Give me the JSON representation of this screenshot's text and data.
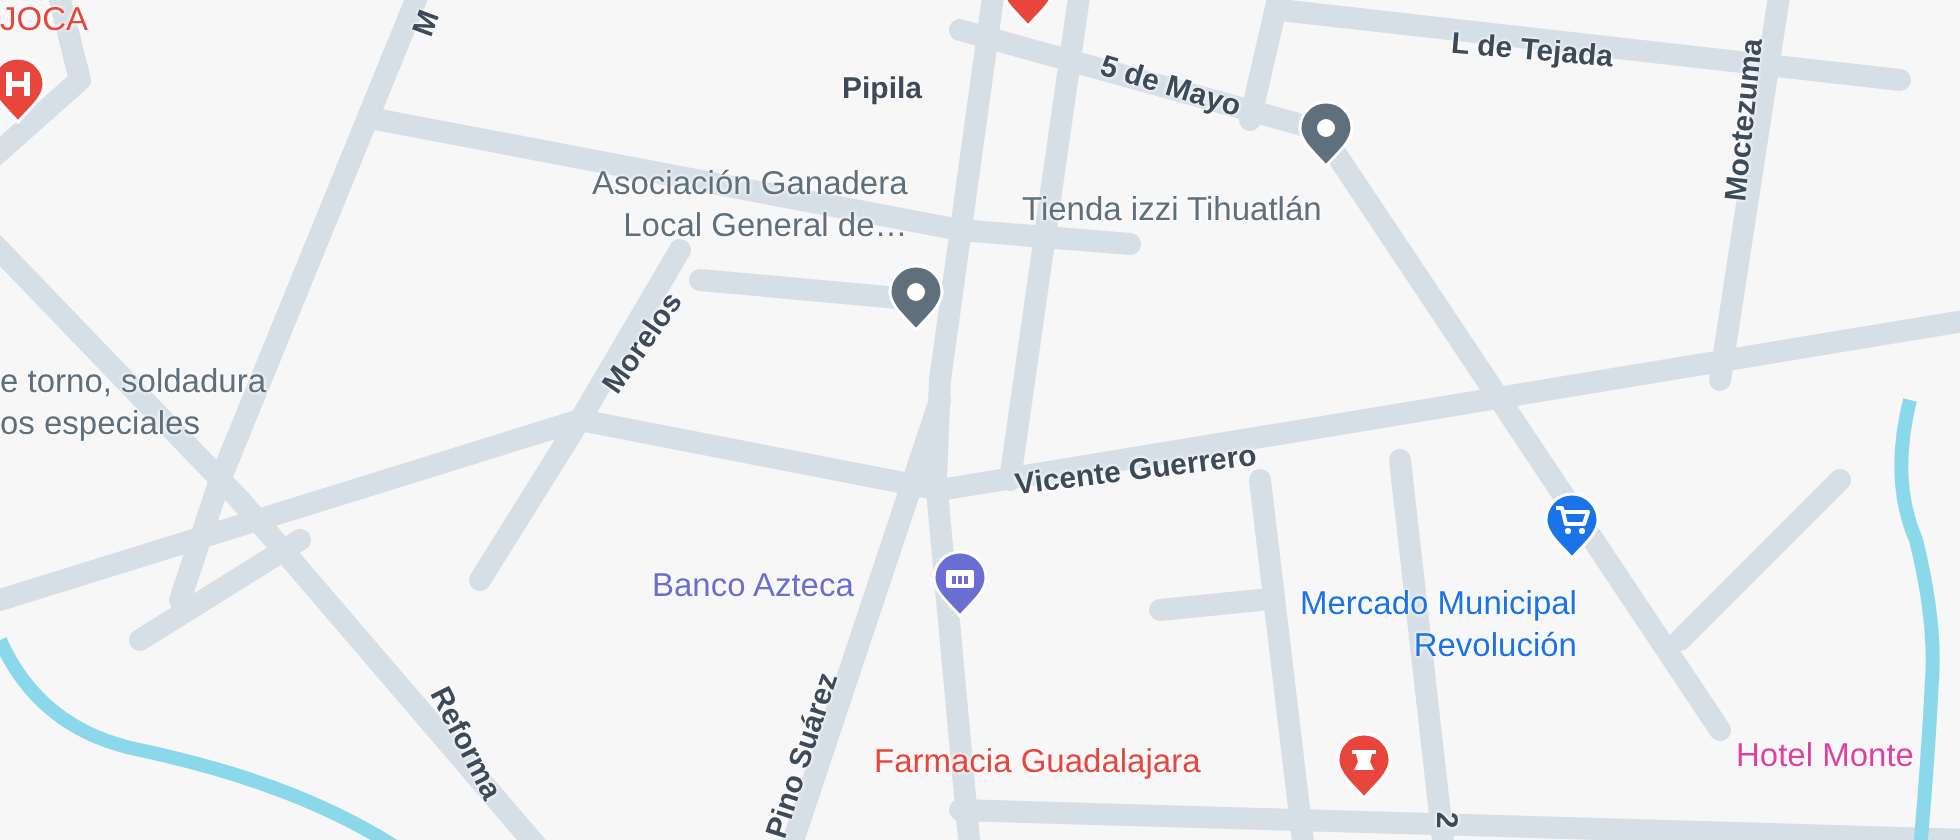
{
  "streets": [
    {
      "name": "M"
    },
    {
      "name": "Pipila"
    },
    {
      "name": "5 de Mayo"
    },
    {
      "name": "L de Tejada"
    },
    {
      "name": "Moctezuma"
    },
    {
      "name": "Morelos"
    },
    {
      "name": "Vicente Guerrero"
    },
    {
      "name": "Reforma"
    },
    {
      "name": "Pino Suárez"
    },
    {
      "name": "2"
    }
  ],
  "places": [
    {
      "kind": "hospital",
      "color": "#e8453c",
      "lines": [
        "JOCA"
      ]
    },
    {
      "kind": "label",
      "color": "#5f6f7b",
      "lines": [
        "e torno, soldadura",
        "os especiales"
      ]
    },
    {
      "kind": "generic",
      "color": "#5f6f7b",
      "lines": [
        "Asociación Ganadera",
        "Local General de…"
      ]
    },
    {
      "kind": "generic",
      "color": "#5f6f7b",
      "lines": [
        "Tienda izzi Tihuatlán"
      ]
    },
    {
      "kind": "bank",
      "color": "#6a6ed2",
      "lines": [
        "Banco Azteca"
      ]
    },
    {
      "kind": "shop",
      "color": "#1a73e8",
      "lines": [
        "Mercado Municipal",
        "Revolución"
      ]
    },
    {
      "kind": "pharmacy",
      "color": "#e8453c",
      "lines": [
        "Farmacia Guadalajara"
      ]
    },
    {
      "kind": "hotel",
      "color": "#e0409f",
      "lines": [
        "Hotel Monte"
      ]
    }
  ]
}
